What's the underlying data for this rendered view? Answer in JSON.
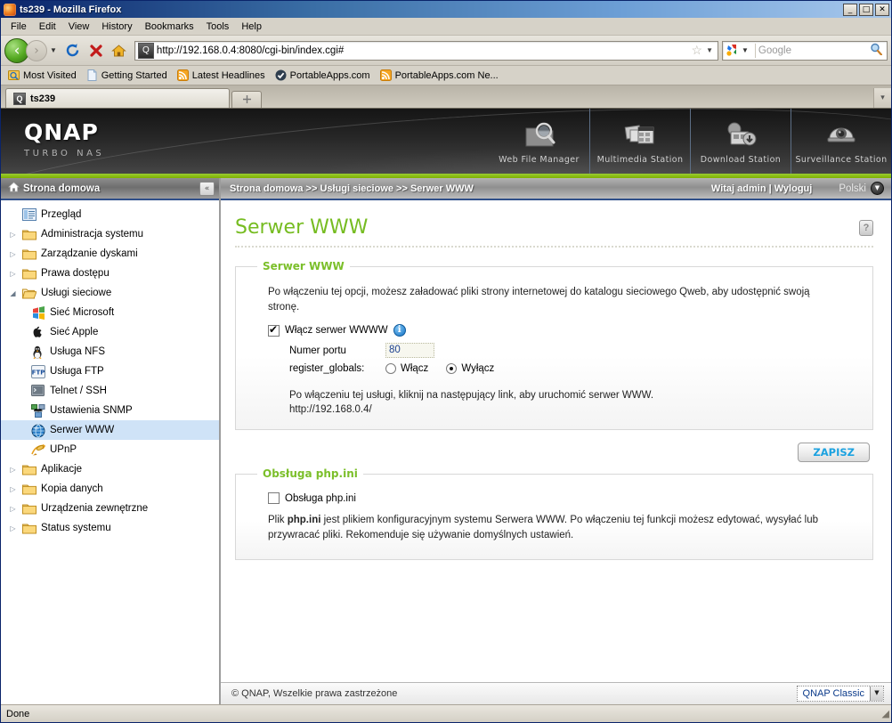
{
  "browser": {
    "title": "ts239 - Mozilla Firefox",
    "icon": "firefox-icon",
    "window_buttons": {
      "minimize": "_",
      "maximize": "□",
      "close": "✕"
    },
    "menu": [
      "File",
      "Edit",
      "View",
      "History",
      "Bookmarks",
      "Tools",
      "Help"
    ],
    "nav": {
      "back_icon": "back-arrow-icon",
      "forward_icon": "forward-arrow-icon",
      "dropdown_icon": "chevron-down-icon",
      "reload_icon": "reload-icon",
      "stop_icon": "stop-icon",
      "home_icon": "home-icon"
    },
    "url": "http://192.168.0.4:8080/cgi-bin/index.cgi#",
    "url_favicon": "qnap-favicon",
    "bookmark_star_icon": "star-icon",
    "search": {
      "placeholder": "Google",
      "engine_icon": "google-icon",
      "go_icon": "magnifier-icon"
    },
    "bookmarks": [
      {
        "label": "Most Visited",
        "icon": "most-visited-icon"
      },
      {
        "label": "Getting Started",
        "icon": "page-icon"
      },
      {
        "label": "Latest Headlines",
        "icon": "rss-icon"
      },
      {
        "label": "PortableApps.com",
        "icon": "portableapps-icon"
      },
      {
        "label": "PortableApps.com Ne...",
        "icon": "rss-icon"
      }
    ],
    "tabs": [
      {
        "label": "ts239",
        "icon": "qnap-favicon",
        "active": true
      }
    ],
    "new_tab_label": "+",
    "tab_list_icon": "chevron-down-icon",
    "status": "Done"
  },
  "qnap": {
    "brand": {
      "name": "QNAP",
      "tagline": "TURBO NAS"
    },
    "stations": [
      {
        "label": "Web File Manager",
        "icon": "web-file-manager-icon"
      },
      {
        "label": "Multimedia Station",
        "icon": "multimedia-station-icon"
      },
      {
        "label": "Download Station",
        "icon": "download-station-icon"
      },
      {
        "label": "Surveillance Station",
        "icon": "surveillance-station-icon"
      }
    ],
    "sidebar": {
      "header": "Strona domowa",
      "header_icon": "home-icon",
      "collapse_icon": "collapse-left-icon",
      "items": [
        {
          "label": "Przegląd",
          "icon": "overview-icon",
          "arrow": "",
          "indent": 0
        },
        {
          "label": "Administracja systemu",
          "icon": "folder-icon",
          "arrow": "▷",
          "indent": 0
        },
        {
          "label": "Zarządzanie dyskami",
          "icon": "folder-icon",
          "arrow": "▷",
          "indent": 0
        },
        {
          "label": "Prawa dostępu",
          "icon": "folder-icon",
          "arrow": "▷",
          "indent": 0
        },
        {
          "label": "Usługi sieciowe",
          "icon": "folder-open-icon",
          "arrow": "◢",
          "indent": 0
        },
        {
          "label": "Sieć Microsoft",
          "icon": "windows-icon",
          "arrow": "",
          "indent": 1
        },
        {
          "label": "Sieć Apple",
          "icon": "apple-icon",
          "arrow": "",
          "indent": 1
        },
        {
          "label": "Usługa NFS",
          "icon": "linux-penguin-icon",
          "arrow": "",
          "indent": 1
        },
        {
          "label": "Usługa FTP",
          "icon": "ftp-icon",
          "arrow": "",
          "indent": 1
        },
        {
          "label": "Telnet / SSH",
          "icon": "terminal-icon",
          "arrow": "",
          "indent": 1
        },
        {
          "label": "Ustawienia SNMP",
          "icon": "snmp-icon",
          "arrow": "",
          "indent": 1
        },
        {
          "label": "Serwer WWW",
          "icon": "globe-icon",
          "arrow": "",
          "indent": 1,
          "selected": true
        },
        {
          "label": "UPnP",
          "icon": "upnp-icon",
          "arrow": "",
          "indent": 1
        },
        {
          "label": "Aplikacje",
          "icon": "folder-icon",
          "arrow": "▷",
          "indent": 0
        },
        {
          "label": "Kopia danych",
          "icon": "folder-icon",
          "arrow": "▷",
          "indent": 0
        },
        {
          "label": "Urządzenia zewnętrzne",
          "icon": "folder-icon",
          "arrow": "▷",
          "indent": 0
        },
        {
          "label": "Status systemu",
          "icon": "folder-icon",
          "arrow": "▷",
          "indent": 0
        }
      ]
    },
    "breadcrumb": "Strona domowa >> Usługi sieciowe >> Serwer WWW",
    "welcome": "Witaj admin | Wyloguj",
    "language": "Polski",
    "language_dropdown_icon": "chevron-down-circle-icon",
    "page_title": "Serwer WWW",
    "help_label": "?",
    "webserver": {
      "legend": "Serwer WWW",
      "description": "Po włączeniu tej opcji, możesz załadować pliki strony internetowej do katalogu sieciowego Qweb, aby udostępnić swoją stronę.",
      "enable_label": "Włącz serwer WWWW",
      "enable_checked": true,
      "info_icon": "info-icon",
      "port_label": "Numer portu",
      "port_value": "80",
      "register_globals_label": "register_globals:",
      "register_globals_options": [
        {
          "label": "Włącz",
          "selected": false
        },
        {
          "label": "Wyłącz",
          "selected": true
        }
      ],
      "link_note": "Po włączeniu tej usługi, kliknij na następujący link, aby uruchomić serwer WWW.",
      "link_url": "http://192.168.0.4/"
    },
    "save_label": "ZAPISZ",
    "phpini": {
      "legend": "Obsługa php.ini",
      "checkbox_label": "Obsługa php.ini",
      "checked": false,
      "desc_prefix": "Plik ",
      "desc_bold": "php.ini",
      "desc_rest": " jest plikiem konfiguracyjnym systemu Serwera WWW. Po włączeniu tej funkcji możesz edytować, wysyłać lub przywracać pliki. Rekomenduje się używanie domyślnych ustawień."
    },
    "footer": {
      "copyright": "© QNAP, Wszelkie prawa zastrzeżone",
      "skin": "QNAP Classic",
      "skin_arrow_icon": "chevron-down-icon"
    },
    "colors": {
      "accent_green": "#76bc21",
      "link_blue": "#1ca2e0",
      "selected_row": "#cfe3f7"
    }
  }
}
